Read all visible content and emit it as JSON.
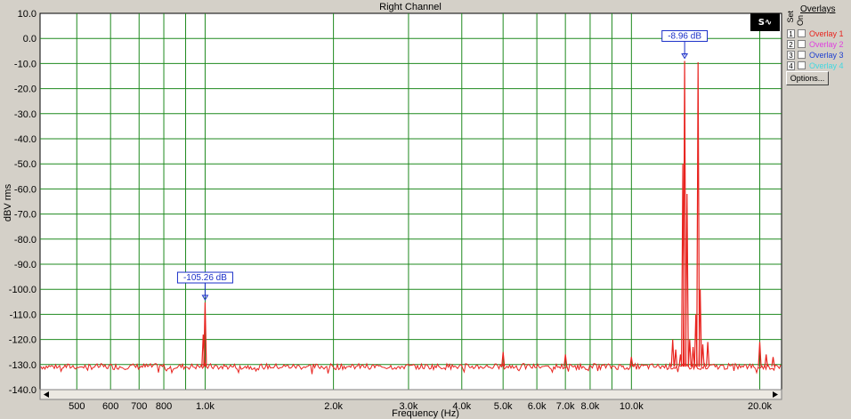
{
  "chart_data": {
    "type": "line",
    "title": "Right Channel",
    "xlabel": "Frequency (Hz)",
    "ylabel": "dBV rms",
    "x_scale": "log",
    "xlim": [
      410,
      22500
    ],
    "ylim": [
      -140,
      10
    ],
    "grid": true,
    "y_ticks": [
      10,
      0,
      -10,
      -20,
      -30,
      -40,
      -50,
      -60,
      -70,
      -80,
      -90,
      -100,
      -110,
      -120,
      -130,
      -140
    ],
    "y_tick_labels": [
      "10.0",
      "0.0",
      "-10.0",
      "-20.0",
      "-30.0",
      "-40.0",
      "-50.0",
      "-60.0",
      "-70.0",
      "-80.0",
      "-90.0",
      "-100.0",
      "-110.0",
      "-120.0",
      "-130.0",
      "-140.0"
    ],
    "x_ticks": [
      500,
      600,
      700,
      800,
      1000,
      2000,
      3000,
      4000,
      5000,
      6000,
      7000,
      8000,
      10000,
      20000
    ],
    "x_tick_labels": [
      "500",
      "600",
      "700",
      "800",
      "1.0k",
      "2.0k",
      "3.0k",
      "4.0k",
      "5.0k",
      "6.0k",
      "7.0k",
      "8.0k",
      "10.0k",
      "20.0k"
    ],
    "noise_floor": -130.8,
    "peaks": [
      {
        "x": 1000,
        "y": -105.26
      },
      {
        "x": 990,
        "y": -118
      },
      {
        "x": 5000,
        "y": -125
      },
      {
        "x": 7000,
        "y": -126
      },
      {
        "x": 10000,
        "y": -127
      },
      {
        "x": 12500,
        "y": -120
      },
      {
        "x": 12700,
        "y": -124
      },
      {
        "x": 13030,
        "y": -126
      },
      {
        "x": 13200,
        "y": -50
      },
      {
        "x": 13330,
        "y": -8.96
      },
      {
        "x": 13500,
        "y": -62
      },
      {
        "x": 13700,
        "y": -120
      },
      {
        "x": 13950,
        "y": -123
      },
      {
        "x": 14160,
        "y": -110
      },
      {
        "x": 14330,
        "y": -9.5
      },
      {
        "x": 14500,
        "y": -100
      },
      {
        "x": 14700,
        "y": -122
      },
      {
        "x": 15100,
        "y": -121
      },
      {
        "x": 20000,
        "y": -121
      },
      {
        "x": 20700,
        "y": -126
      },
      {
        "x": 21500,
        "y": -127
      }
    ],
    "series": [
      {
        "color": "#e8231e"
      }
    ],
    "annotations": [
      {
        "text": "-105.26 dB",
        "x": 1000,
        "y": -105.26
      },
      {
        "text": "-8.96 dB",
        "x": 13330,
        "y": -8.96
      }
    ]
  },
  "panel": {
    "header": "Overlays",
    "set_label": "Set",
    "on_label": "On",
    "overlays": [
      {
        "num": "1",
        "label": "Overlay 1",
        "color": "#e8231e"
      },
      {
        "num": "2",
        "label": "Overlay 2",
        "color": "#e040e0"
      },
      {
        "num": "3",
        "label": "Overlay 3",
        "color": "#2040d0"
      },
      {
        "num": "4",
        "label": "Overlay 4",
        "color": "#40d8e0"
      }
    ],
    "options_label": "Options...",
    "mode_label": "S∿"
  },
  "colors": {
    "plot_bg": "#ffffff",
    "grid": "#1f8a1f",
    "trace": "#e8231e",
    "callout": "#1a2fc8"
  }
}
